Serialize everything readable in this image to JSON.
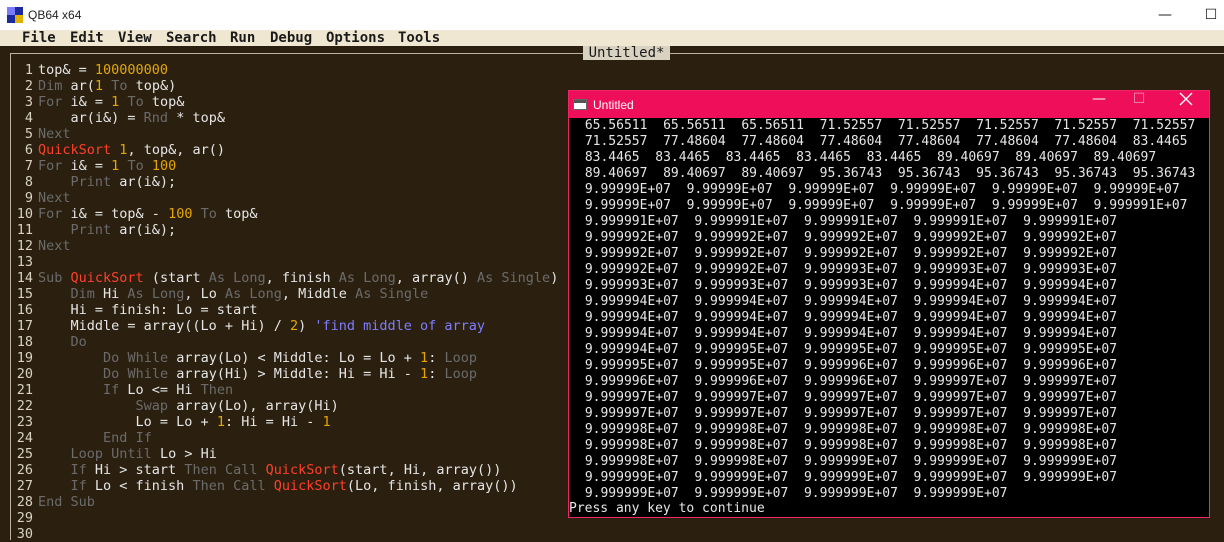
{
  "window": {
    "title": "QB64 x64",
    "minimize_glyph": "—",
    "maximize_glyph": "☐"
  },
  "menu": [
    "File",
    "Edit",
    "View",
    "Search",
    "Run",
    "Debug",
    "Options",
    "Tools"
  ],
  "editor": {
    "tab_title": "Untitled*",
    "line_numbers": [
      "1",
      "2",
      "3",
      "4",
      "5",
      "6",
      "7",
      "8",
      "9",
      "10",
      "11",
      "12",
      "13",
      "14",
      "15",
      "16",
      "17",
      "18",
      "19",
      "20",
      "21",
      "22",
      "23",
      "24",
      "25",
      "26",
      "27",
      "28",
      "29",
      "30"
    ],
    "lines": [
      [
        [
          "t",
          "top& = "
        ],
        [
          "num",
          "100000000"
        ]
      ],
      [
        [
          "kw",
          "Dim"
        ],
        [
          "t",
          " ar("
        ],
        [
          "num",
          "1"
        ],
        [
          "t",
          " "
        ],
        [
          "kw",
          "To"
        ],
        [
          "t",
          " top&)"
        ]
      ],
      [
        [
          "kw",
          "For"
        ],
        [
          "t",
          " i& = "
        ],
        [
          "num",
          "1"
        ],
        [
          "t",
          " "
        ],
        [
          "kw",
          "To"
        ],
        [
          "t",
          " top&"
        ]
      ],
      [
        [
          "t",
          "    ar(i&) = "
        ],
        [
          "kw",
          "Rnd"
        ],
        [
          "t",
          " * top&"
        ]
      ],
      [
        [
          "kw",
          "Next"
        ]
      ],
      [
        [
          "fn",
          "QuickSort"
        ],
        [
          "t",
          " "
        ],
        [
          "num",
          "1"
        ],
        [
          "t",
          ", top&, ar()"
        ]
      ],
      [
        [
          "kw",
          "For"
        ],
        [
          "t",
          " i& = "
        ],
        [
          "num",
          "1"
        ],
        [
          "t",
          " "
        ],
        [
          "kw",
          "To"
        ],
        [
          "t",
          " "
        ],
        [
          "num",
          "100"
        ]
      ],
      [
        [
          "t",
          "    "
        ],
        [
          "kw",
          "Print"
        ],
        [
          "t",
          " ar(i&);"
        ]
      ],
      [
        [
          "kw",
          "Next"
        ]
      ],
      [
        [
          "kw",
          "For"
        ],
        [
          "t",
          " i& = top& - "
        ],
        [
          "num",
          "100"
        ],
        [
          "t",
          " "
        ],
        [
          "kw",
          "To"
        ],
        [
          "t",
          " top&"
        ]
      ],
      [
        [
          "t",
          "    "
        ],
        [
          "kw",
          "Print"
        ],
        [
          "t",
          " ar(i&);"
        ]
      ],
      [
        [
          "kw",
          "Next"
        ]
      ],
      [],
      [
        [
          "kw",
          "Sub"
        ],
        [
          "t",
          " "
        ],
        [
          "fn",
          "QuickSort"
        ],
        [
          "t",
          " (start "
        ],
        [
          "kw",
          "As"
        ],
        [
          "t",
          " "
        ],
        [
          "kw",
          "Long"
        ],
        [
          "t",
          ", finish "
        ],
        [
          "kw",
          "As"
        ],
        [
          "t",
          " "
        ],
        [
          "kw",
          "Long"
        ],
        [
          "t",
          ", array() "
        ],
        [
          "kw",
          "As"
        ],
        [
          "t",
          " "
        ],
        [
          "kw",
          "Single"
        ],
        [
          "t",
          ")"
        ]
      ],
      [
        [
          "t",
          "    "
        ],
        [
          "kw",
          "Dim"
        ],
        [
          "t",
          " Hi "
        ],
        [
          "kw",
          "As"
        ],
        [
          "t",
          " "
        ],
        [
          "kw",
          "Long"
        ],
        [
          "t",
          ", Lo "
        ],
        [
          "kw",
          "As"
        ],
        [
          "t",
          " "
        ],
        [
          "kw",
          "Long"
        ],
        [
          "t",
          ", Middle "
        ],
        [
          "kw",
          "As"
        ],
        [
          "t",
          " "
        ],
        [
          "kw",
          "Single"
        ]
      ],
      [
        [
          "t",
          "    Hi = finish: Lo = start"
        ]
      ],
      [
        [
          "t",
          "    Middle = array((Lo + Hi) / "
        ],
        [
          "num",
          "2"
        ],
        [
          "t",
          ") "
        ],
        [
          "cm",
          "'find middle of array"
        ]
      ],
      [
        [
          "t",
          "    "
        ],
        [
          "kw",
          "Do"
        ]
      ],
      [
        [
          "t",
          "        "
        ],
        [
          "kw",
          "Do"
        ],
        [
          "t",
          " "
        ],
        [
          "kw",
          "While"
        ],
        [
          "t",
          " array(Lo) < Middle: Lo = Lo + "
        ],
        [
          "num",
          "1"
        ],
        [
          "t",
          ": "
        ],
        [
          "kw",
          "Loop"
        ]
      ],
      [
        [
          "t",
          "        "
        ],
        [
          "kw",
          "Do"
        ],
        [
          "t",
          " "
        ],
        [
          "kw",
          "While"
        ],
        [
          "t",
          " array(Hi) > Middle: Hi = Hi - "
        ],
        [
          "num",
          "1"
        ],
        [
          "t",
          ": "
        ],
        [
          "kw",
          "Loop"
        ]
      ],
      [
        [
          "t",
          "        "
        ],
        [
          "kw",
          "If"
        ],
        [
          "t",
          " Lo <= Hi "
        ],
        [
          "kw",
          "Then"
        ]
      ],
      [
        [
          "t",
          "            "
        ],
        [
          "kw",
          "Swap"
        ],
        [
          "t",
          " array(Lo), array(Hi)"
        ]
      ],
      [
        [
          "t",
          "            Lo = Lo + "
        ],
        [
          "num",
          "1"
        ],
        [
          "t",
          ": Hi = Hi - "
        ],
        [
          "num",
          "1"
        ]
      ],
      [
        [
          "t",
          "        "
        ],
        [
          "kw",
          "End"
        ],
        [
          "t",
          " "
        ],
        [
          "kw",
          "If"
        ]
      ],
      [
        [
          "t",
          "    "
        ],
        [
          "kw",
          "Loop"
        ],
        [
          "t",
          " "
        ],
        [
          "kw",
          "Until"
        ],
        [
          "t",
          " Lo > Hi"
        ]
      ],
      [
        [
          "t",
          "    "
        ],
        [
          "kw",
          "If"
        ],
        [
          "t",
          " Hi > start "
        ],
        [
          "kw",
          "Then"
        ],
        [
          "t",
          " "
        ],
        [
          "kw",
          "Call"
        ],
        [
          "t",
          " "
        ],
        [
          "fn",
          "QuickSort"
        ],
        [
          "t",
          "(start, Hi, array())"
        ]
      ],
      [
        [
          "t",
          "    "
        ],
        [
          "kw",
          "If"
        ],
        [
          "t",
          " Lo < finish "
        ],
        [
          "kw",
          "Then"
        ],
        [
          "t",
          " "
        ],
        [
          "kw",
          "Call"
        ],
        [
          "t",
          " "
        ],
        [
          "fn",
          "QuickSort"
        ],
        [
          "t",
          "(Lo, finish, array())"
        ]
      ],
      [
        [
          "kw",
          "End"
        ],
        [
          "t",
          " "
        ],
        [
          "kw",
          "Sub"
        ]
      ],
      [],
      []
    ]
  },
  "output_window": {
    "title": "Untitled",
    "minimize_glyph": "—",
    "maximize_glyph": "☐",
    "lines": [
      " 65.56511  65.56511  65.56511  71.52557  71.52557  71.52557  71.52557  71.52557",
      " 71.52557  77.48604  77.48604  77.48604  77.48604  77.48604  77.48604  83.4465",
      " 83.4465  83.4465  83.4465  83.4465  83.4465  89.40697  89.40697  89.40697",
      " 89.40697  89.40697  89.40697  95.36743  95.36743  95.36743  95.36743  95.36743",
      " 9.99999E+07  9.99999E+07  9.99999E+07  9.99999E+07  9.99999E+07  9.99999E+07",
      " 9.99999E+07  9.99999E+07  9.99999E+07  9.99999E+07  9.99999E+07  9.999991E+07",
      " 9.999991E+07  9.999991E+07  9.999991E+07  9.999991E+07  9.999991E+07",
      " 9.999992E+07  9.999992E+07  9.999992E+07  9.999992E+07  9.999992E+07",
      " 9.999992E+07  9.999992E+07  9.999992E+07  9.999992E+07  9.999992E+07",
      " 9.999992E+07  9.999992E+07  9.999993E+07  9.999993E+07  9.999993E+07",
      " 9.999993E+07  9.999993E+07  9.999993E+07  9.999994E+07  9.999994E+07",
      " 9.999994E+07  9.999994E+07  9.999994E+07  9.999994E+07  9.999994E+07",
      " 9.999994E+07  9.999994E+07  9.999994E+07  9.999994E+07  9.999994E+07",
      " 9.999994E+07  9.999994E+07  9.999994E+07  9.999994E+07  9.999994E+07",
      " 9.999994E+07  9.999995E+07  9.999995E+07  9.999995E+07  9.999995E+07",
      " 9.999995E+07  9.999995E+07  9.999996E+07  9.999996E+07  9.999996E+07",
      " 9.999996E+07  9.999996E+07  9.999996E+07  9.999997E+07  9.999997E+07",
      " 9.999997E+07  9.999997E+07  9.999997E+07  9.999997E+07  9.999997E+07",
      " 9.999997E+07  9.999997E+07  9.999997E+07  9.999997E+07  9.999997E+07",
      " 9.999998E+07  9.999998E+07  9.999998E+07  9.999998E+07  9.999998E+07",
      " 9.999998E+07  9.999998E+07  9.999998E+07  9.999998E+07  9.999998E+07",
      " 9.999998E+07  9.999998E+07  9.999999E+07  9.999999E+07  9.999999E+07",
      " 9.999999E+07  9.999999E+07  9.999999E+07  9.999999E+07  9.999999E+07",
      " 9.999999E+07  9.999999E+07  9.999999E+07  9.999999E+07"
    ],
    "prompt": "Press any key to continue"
  }
}
